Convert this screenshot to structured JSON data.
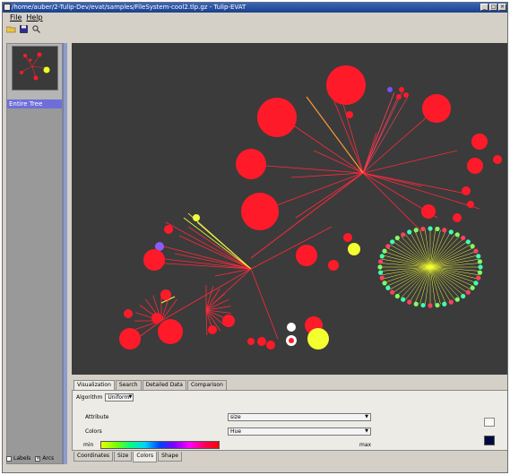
{
  "window": {
    "title": "/home/auber/2-Tulip-Dev/evat/samples/FileSystem-cool2.tlp.gz - Tulip-EVAT"
  },
  "menu": [
    {
      "label": "File"
    },
    {
      "label": "Help"
    }
  ],
  "toolbar": [
    {
      "icon": "open-folder-icon"
    },
    {
      "icon": "save-icon"
    },
    {
      "icon": "zoom-icon"
    }
  ],
  "tree": {
    "items": [
      {
        "label": "Entire Tree",
        "selected": true
      }
    ]
  },
  "top_tabs": [
    {
      "label": "Visualization",
      "active": true
    },
    {
      "label": "Search"
    },
    {
      "label": "Detailed Data"
    },
    {
      "label": "Comparison"
    }
  ],
  "controls": {
    "algorithm_label": "Algorithm",
    "algorithm_value": "Uniform",
    "attribute_label": "Attribute",
    "attribute_value": "size",
    "colors_label": "Colors",
    "colors_value": "Hue",
    "min_label": "min",
    "max_label": "max"
  },
  "bottom_tabs": [
    {
      "label": "Coordinates"
    },
    {
      "label": "Size"
    },
    {
      "label": "Colors",
      "active": true
    },
    {
      "label": "Shape"
    }
  ],
  "status": {
    "labels_label": "Labels",
    "labels_checked": false,
    "arcs_label": "Arcs",
    "arcs_checked": true
  },
  "colors": {
    "canvas_bg": "#3b3b3b",
    "node": "#ff1a2a",
    "selection_highlight": "#6e6edb",
    "swatch_light": "#f8f8f8",
    "swatch_dark": "#000a40"
  }
}
